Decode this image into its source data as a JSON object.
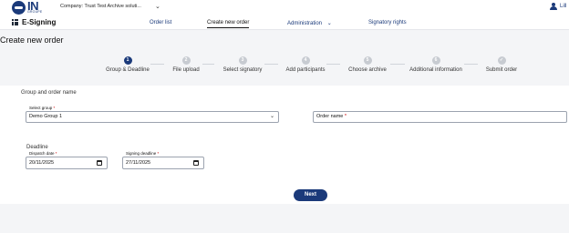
{
  "header": {
    "logo_text": "IN",
    "logo_subtext": "GROUPE",
    "company": "Company: Trust Test Archive soluti...",
    "user_name": "Lill"
  },
  "nav": {
    "app_name": "E-Signing",
    "items": [
      {
        "label": "Order list"
      },
      {
        "label": "Create new order"
      },
      {
        "label": "Administration"
      },
      {
        "label": "Signatory rights"
      }
    ]
  },
  "page": {
    "title": "Create new order"
  },
  "stepper": {
    "active_index": 0,
    "steps": [
      {
        "num": "1",
        "label": "Group & Deadline"
      },
      {
        "num": "2",
        "label": "File upload"
      },
      {
        "num": "3",
        "label": "Select signatory"
      },
      {
        "num": "4",
        "label": "Add participants"
      },
      {
        "num": "5",
        "label": "Choose archive"
      },
      {
        "num": "6",
        "label": "Additional information"
      },
      {
        "num": "✓",
        "label": "Submit order"
      }
    ]
  },
  "form": {
    "section_title": "Group and order name",
    "select_group_label": "Select group",
    "select_group_value": "Demo Group 1",
    "order_name_label": "Order name",
    "deadline_title": "Deadline",
    "dispatch_label": "Dispatch date",
    "dispatch_value": "20/11/2025",
    "signing_label": "Signing deadline",
    "signing_value": "27/11/2025",
    "required_mark": "*"
  },
  "actions": {
    "next_label": "Next"
  },
  "colors": {
    "brand": "#1b3a7a",
    "inactive_step": "#c7cbd1"
  }
}
